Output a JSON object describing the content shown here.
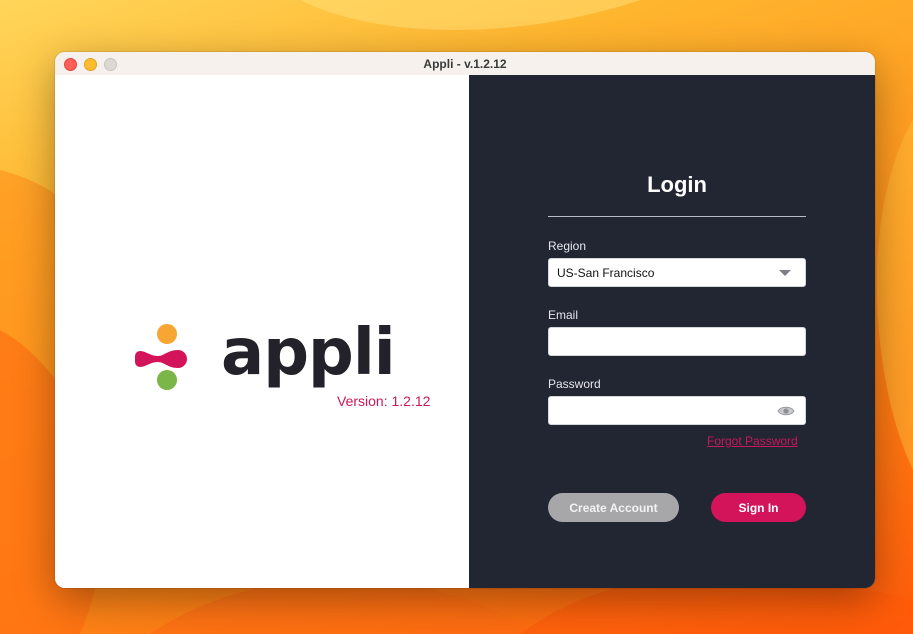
{
  "window": {
    "title": "Appli - v.1.2.12"
  },
  "brand": {
    "wordmark": "appli",
    "version": "Version: 1.2.12",
    "colors": {
      "orange_dot": "#f7a533",
      "pink_mark": "#d3145a",
      "green_dot": "#7ab648",
      "wordmark": "#23222b"
    }
  },
  "login": {
    "title": "Login",
    "region": {
      "label": "Region",
      "value": "US-San Francisco",
      "icon": "chevron-down-icon"
    },
    "email": {
      "label": "Email",
      "value": ""
    },
    "password": {
      "label": "Password",
      "value": "",
      "toggle_icon": "eye-icon"
    },
    "forgot_password": "Forgot Password",
    "create_account": "Create Account",
    "sign_in": "Sign In"
  },
  "theme": {
    "panel_dark": "#222532",
    "accent": "#d3145a",
    "secondary_button": "#a7a7a9"
  }
}
